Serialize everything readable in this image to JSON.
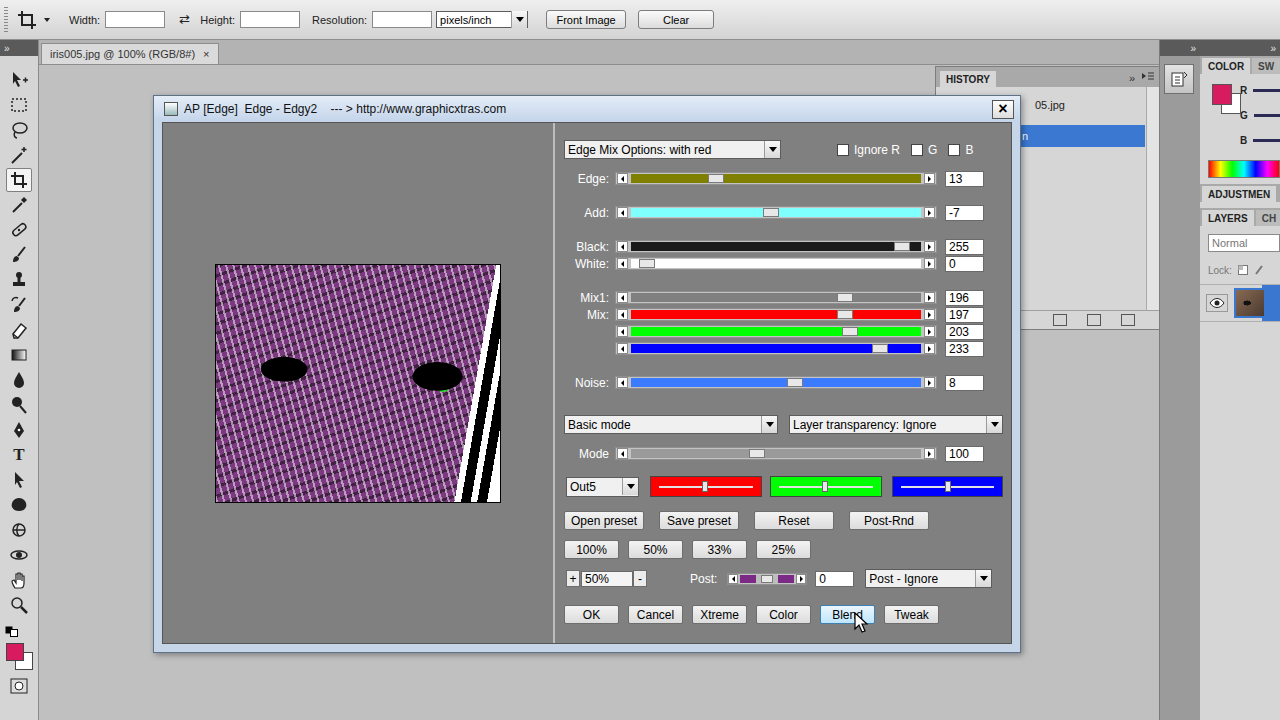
{
  "options_bar": {
    "width_label": "Width:",
    "swap": "⇄",
    "height_label": "Height:",
    "resolution_label": "Resolution:",
    "units": "pixels/inch",
    "buttons": [
      "Front Image",
      "Clear"
    ]
  },
  "tools_header": "»",
  "tools": [
    {
      "kind": "move",
      "selected": false
    },
    {
      "kind": "marquee",
      "selected": false
    },
    {
      "kind": "lasso",
      "selected": false
    },
    {
      "kind": "wand",
      "selected": false
    },
    {
      "kind": "crop",
      "selected": true
    },
    {
      "kind": "eyedropper",
      "selected": false
    },
    {
      "kind": "healing",
      "selected": false
    },
    {
      "kind": "brush",
      "selected": false
    },
    {
      "kind": "stamp",
      "selected": false
    },
    {
      "kind": "historybrush",
      "selected": false
    },
    {
      "kind": "eraser",
      "selected": false
    },
    {
      "kind": "gradient",
      "selected": false
    },
    {
      "kind": "blur",
      "selected": false
    },
    {
      "kind": "dodge",
      "selected": false
    },
    {
      "kind": "pen",
      "selected": false
    },
    {
      "kind": "type",
      "glyph": "T",
      "selected": false
    },
    {
      "kind": "pathselect",
      "selected": false
    },
    {
      "kind": "shape",
      "selected": false
    },
    {
      "kind": "rotate3d",
      "selected": false
    },
    {
      "kind": "orbit3d",
      "selected": false
    },
    {
      "kind": "hand",
      "selected": false
    },
    {
      "kind": "zoom",
      "selected": false
    }
  ],
  "colors": {
    "foreground": "#d81b5e",
    "background": "#ffffff"
  },
  "document_tab": {
    "title": "iris005.jpg @ 100% (RGB/8#)",
    "close": "×"
  },
  "dock_header": "»",
  "history": {
    "title": "HISTORY",
    "expand": "»",
    "items": [
      {
        "kind": "snapshot",
        "label": "05.jpg",
        "selected": false
      },
      {
        "kind": "step",
        "label": "n",
        "selected": true
      }
    ]
  },
  "panels_header": "»",
  "color_panel": {
    "tabs": [
      {
        "label": "COLOR",
        "selected": true
      },
      {
        "label": "SW",
        "selected": false
      }
    ],
    "channels": [
      "R",
      "G",
      "B"
    ]
  },
  "adjustments": {
    "tabs": [
      {
        "label": "ADJUSTMEN",
        "selected": true
      }
    ]
  },
  "layers": {
    "tabs": [
      {
        "label": "LAYERS",
        "selected": true
      },
      {
        "label": "CH",
        "selected": false
      }
    ],
    "blend_mode": "Normal",
    "lock_label": "Lock:",
    "rows": [
      {
        "visible": true,
        "selected": true
      }
    ]
  },
  "dialog": {
    "title": "AP [Edge]  Edge - Edgy2    --- > http://www.graphicxtras.com",
    "close": "×",
    "mix_options": "Edge Mix Options: with red",
    "ignore": [
      {
        "label": "Ignore R",
        "checked": false
      },
      {
        "label": "G",
        "checked": false
      },
      {
        "label": "B",
        "checked": false
      }
    ],
    "slider_groups": [
      [
        {
          "label": "Edge:",
          "value": "13",
          "level": 0.28,
          "color": "#7f7f00"
        }
      ],
      [
        {
          "label": "Add:",
          "value": "-7",
          "level": 0.48,
          "color": "#80ffff"
        }
      ],
      [
        {
          "label": "Black:",
          "value": "255",
          "level": 0.96,
          "color": "#1a1a1a"
        },
        {
          "label": "White:",
          "value": "0",
          "level": 0.03,
          "color": "#ffffff"
        }
      ],
      [
        {
          "label": "Mix1:",
          "value": "196",
          "level": 0.75,
          "color": "#808080"
        },
        {
          "label": "Mix:",
          "value": "197",
          "level": 0.75,
          "color": "#ff0000"
        },
        {
          "value": "203",
          "level": 0.77,
          "color": "#00ff00"
        },
        {
          "value": "233",
          "level": 0.88,
          "color": "#0000ff"
        }
      ],
      [
        {
          "label": "Noise:",
          "value": "8",
          "level": 0.57,
          "color": "#3a7bff"
        }
      ]
    ],
    "mode_dropdown": "Basic mode",
    "transparency_dropdown": "Layer transparency: Ignore",
    "mode_slider": {
      "label": "Mode",
      "value": "100",
      "level": 0.43,
      "color": "#9a9a9a"
    },
    "out_dropdown": "Out5",
    "channel_bars": [
      {
        "color": "#ff0000",
        "level": 0.49
      },
      {
        "color": "#00ff00",
        "level": 0.49
      },
      {
        "color": "#0000ff",
        "level": 0.5
      }
    ],
    "preset_buttons": [
      "Open preset",
      "Save preset",
      "Reset",
      "Post-Rnd"
    ],
    "zoom_buttons": [
      "100%",
      "50%",
      "33%",
      "25%"
    ],
    "zoom": {
      "plus": "+",
      "value": "50%",
      "minus": "-"
    },
    "post": {
      "label": "Post:",
      "level": 0.5,
      "value": "0",
      "dropdown": "Post - Ignore"
    },
    "action_buttons": [
      {
        "label": "OK",
        "hovered": false
      },
      {
        "label": "Cancel",
        "hovered": false
      },
      {
        "label": "Xtreme",
        "hovered": false
      },
      {
        "label": "Color",
        "hovered": false
      },
      {
        "label": "Blend",
        "hovered": true
      },
      {
        "label": "Tweak",
        "hovered": false
      }
    ]
  }
}
